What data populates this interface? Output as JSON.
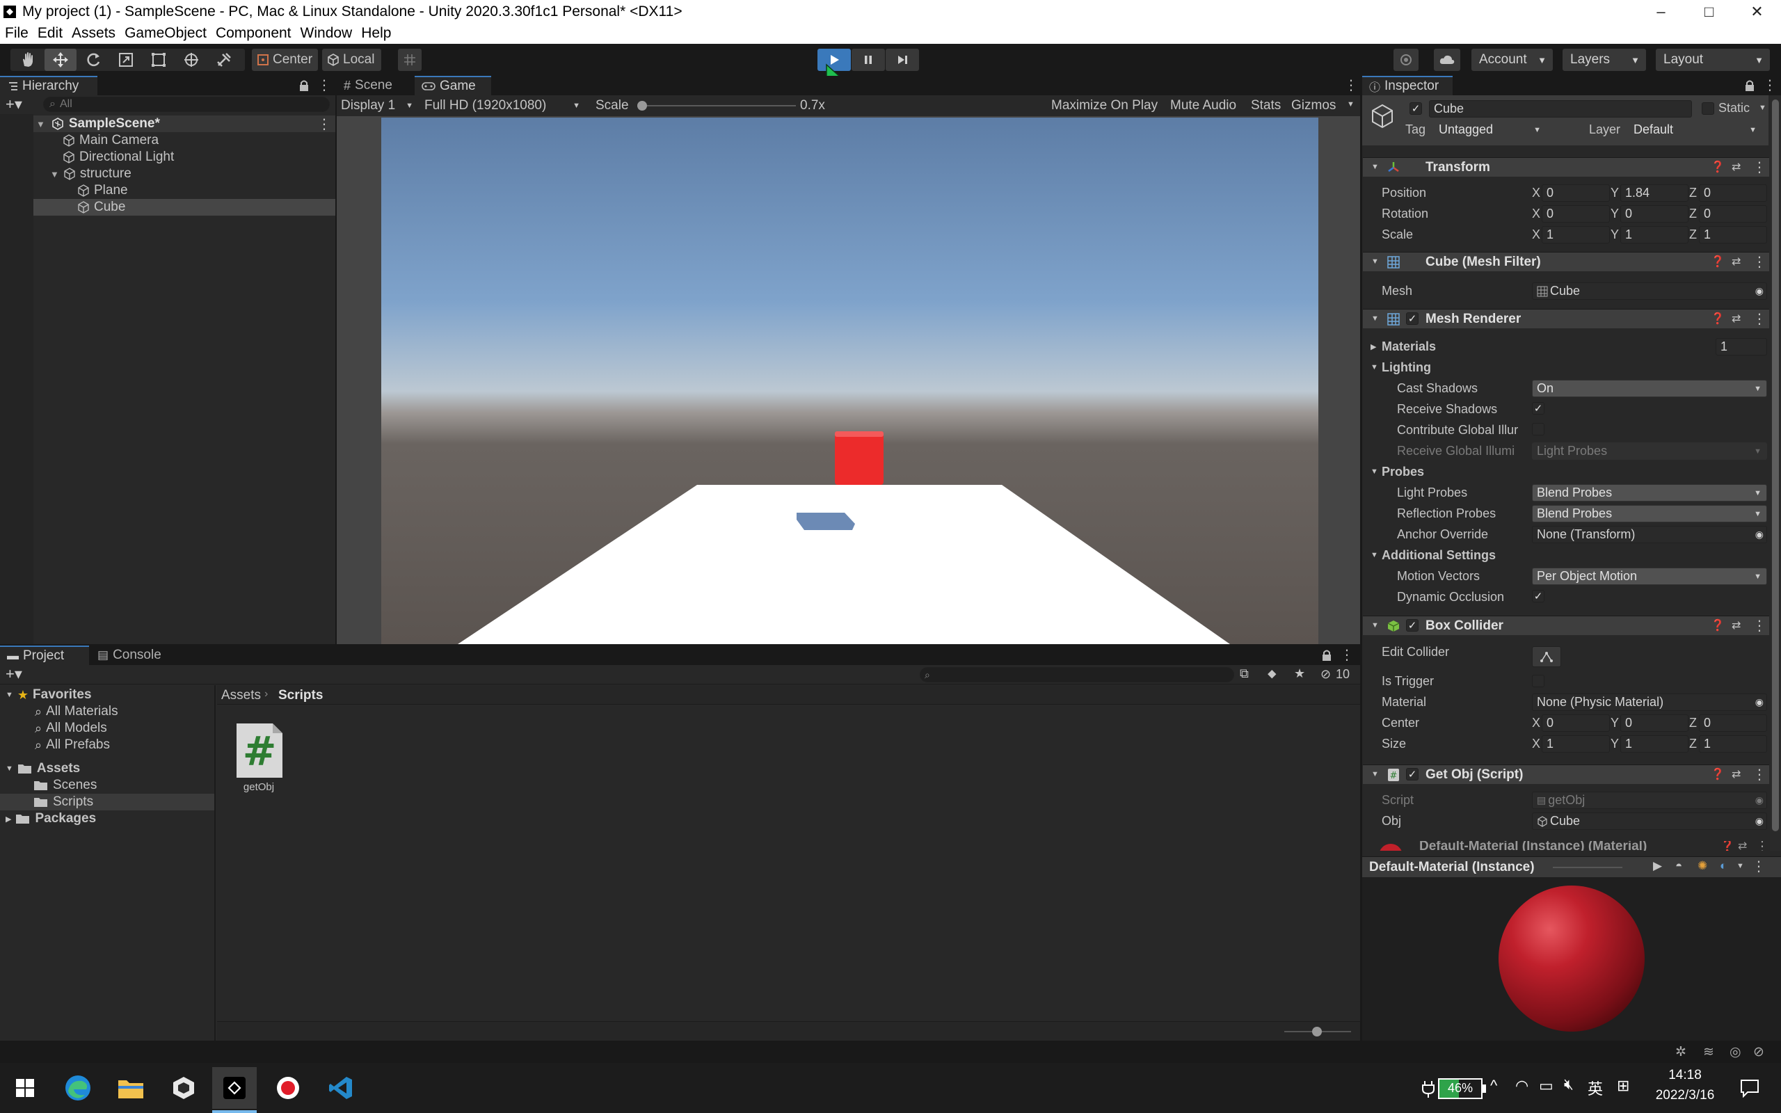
{
  "window": {
    "title": "My project (1) - SampleScene - PC, Mac & Linux Standalone - Unity 2020.3.30f1c1 Personal* <DX11>",
    "controls": [
      "–",
      "□",
      "✕"
    ]
  },
  "menu": [
    "File",
    "Edit",
    "Assets",
    "GameObject",
    "Component",
    "Window",
    "Help"
  ],
  "toolbar": {
    "pivot": "Center",
    "space": "Local",
    "account": "Account",
    "layers": "Layers",
    "layout": "Layout"
  },
  "hierarchy": {
    "tab": "Hierarchy",
    "search_placeholder": "All",
    "scene": "SampleScene*",
    "items": [
      {
        "label": "Main Camera"
      },
      {
        "label": "Directional Light"
      },
      {
        "label": "structure"
      },
      {
        "label": "Plane"
      },
      {
        "label": "Cube"
      }
    ]
  },
  "game": {
    "tabs": [
      "Scene",
      "Game"
    ],
    "display": "Display 1",
    "resolution": "Full HD (1920x1080)",
    "scale_label": "Scale",
    "scale_value": "0.7x",
    "buttons": [
      "Maximize On Play",
      "Mute Audio",
      "Stats",
      "Gizmos"
    ]
  },
  "project": {
    "tabs": [
      "Project",
      "Console"
    ],
    "breadcrumb": [
      "Assets",
      "Scripts"
    ],
    "favorites": "Favorites",
    "fav_items": [
      "All Materials",
      "All Models",
      "All Prefabs"
    ],
    "assets": "Assets",
    "asset_folders": [
      "Scenes",
      "Scripts"
    ],
    "packages": "Packages",
    "hidden_count": "10",
    "file": {
      "name": "getObj",
      "glyph": "#"
    }
  },
  "inspector": {
    "tab": "Inspector",
    "object_name": "Cube",
    "static_label": "Static",
    "tag_label": "Tag",
    "tag_value": "Untagged",
    "layer_label": "Layer",
    "layer_value": "Default",
    "transform": {
      "title": "Transform",
      "position_label": "Position",
      "px": "0",
      "py": "1.84",
      "pz": "0",
      "rotation_label": "Rotation",
      "rx": "0",
      "ry": "0",
      "rz": "0",
      "scale_label": "Scale",
      "sx": "1",
      "sy": "1",
      "sz": "1"
    },
    "mesh_filter": {
      "title": "Cube (Mesh Filter)",
      "mesh_label": "Mesh",
      "mesh_value": "Cube"
    },
    "mesh_renderer": {
      "title": "Mesh Renderer",
      "materials_label": "Materials",
      "materials_count": "1",
      "lighting_label": "Lighting",
      "cast_shadows_label": "Cast Shadows",
      "cast_shadows_value": "On",
      "receive_shadows_label": "Receive Shadows",
      "contribute_gi_label": "Contribute Global Illur",
      "receive_gi_label": "Receive Global Illumi",
      "receive_gi_value": "Light Probes",
      "probes_label": "Probes",
      "light_probes_label": "Light Probes",
      "light_probes_value": "Blend Probes",
      "reflection_probes_label": "Reflection Probes",
      "reflection_probes_value": "Blend Probes",
      "anchor_override_label": "Anchor Override",
      "anchor_override_value": "None (Transform)",
      "additional_label": "Additional Settings",
      "motion_vectors_label": "Motion Vectors",
      "motion_vectors_value": "Per Object Motion",
      "dynamic_occlusion_label": "Dynamic Occlusion"
    },
    "box_collider": {
      "title": "Box Collider",
      "edit_label": "Edit Collider",
      "trigger_label": "Is Trigger",
      "material_label": "Material",
      "material_value": "None (Physic Material)",
      "center_label": "Center",
      "cx": "0",
      "cy": "0",
      "cz": "0",
      "size_label": "Size",
      "sx": "1",
      "sy": "1",
      "sz": "1"
    },
    "script": {
      "title": "Get Obj (Script)",
      "script_label": "Script",
      "script_value": "getObj",
      "obj_label": "Obj",
      "obj_value": "Cube"
    },
    "material_header": "Default-Material (Instance) (Material)",
    "preview_title": "Default-Material (Instance)"
  },
  "taskbar": {
    "battery": "46%",
    "ime": "英",
    "time": "14:18",
    "date": "2022/3/16"
  },
  "colors": {
    "accent": "#3a79bb",
    "cube": "#ec2b2b",
    "sky_top": "#5e7ea6",
    "ground": "#5d5752"
  }
}
